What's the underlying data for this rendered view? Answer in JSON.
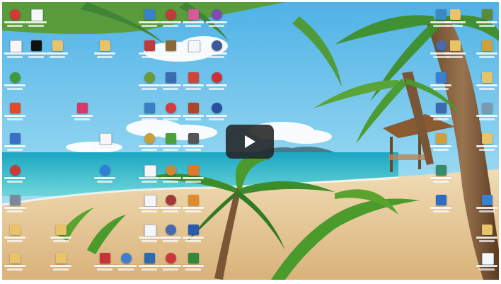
{
  "video": {
    "play_label": "Play",
    "accent": "#232323"
  },
  "desktop": {
    "colors": {
      "sky": "#7ec8ea",
      "sea": "#2fb7c9",
      "sand": "#e8cda0",
      "palm": "#3d8c2a"
    },
    "icons": [
      {
        "kind": "app",
        "color": "#d23a3a",
        "shape": "round"
      },
      {
        "kind": "doc",
        "color": "#f4f6f8",
        "shape": "doc"
      },
      {
        "kind": "doc",
        "color": "#f4f6f8",
        "shape": "doc"
      },
      {
        "kind": "app",
        "color": "#111111",
        "shape": "square"
      },
      {
        "kind": "folder",
        "color": "#e8c36a",
        "shape": "folder"
      },
      {
        "kind": "folder",
        "color": "#e8c36a",
        "shape": "folder"
      },
      {
        "kind": "app",
        "color": "#3f9a3a",
        "shape": "round"
      },
      {
        "kind": "app",
        "color": "#e04b2c",
        "shape": "square"
      },
      {
        "kind": "app",
        "color": "#d63a6a",
        "shape": "square"
      },
      {
        "kind": "app",
        "color": "#3a6fc4",
        "shape": "square"
      },
      {
        "kind": "mail",
        "color": "#f4f6f8",
        "shape": "doc"
      },
      {
        "kind": "app",
        "color": "#c83a3a",
        "shape": "round"
      },
      {
        "kind": "app",
        "color": "#2f7ed8",
        "shape": "round"
      },
      {
        "kind": "app",
        "color": "#7a8a9a",
        "shape": "square"
      },
      {
        "kind": "folder",
        "color": "#e8c36a",
        "shape": "folder"
      },
      {
        "kind": "folder",
        "color": "#e8c36a",
        "shape": "folder"
      },
      {
        "kind": "folder",
        "color": "#e8c36a",
        "shape": "folder"
      },
      {
        "kind": "folder",
        "color": "#e8c36a",
        "shape": "folder"
      },
      {
        "kind": "folder",
        "color": "#e8c36a",
        "shape": "folder"
      },
      {
        "kind": "folder",
        "color": "#e8c36a",
        "shape": "folder"
      },
      {
        "kind": "app",
        "color": "#3a7fd0",
        "shape": "square"
      },
      {
        "kind": "app",
        "color": "#c23a3a",
        "shape": "round"
      },
      {
        "kind": "app",
        "color": "#d55a9a",
        "shape": "square"
      },
      {
        "kind": "app",
        "color": "#7a4fb0",
        "shape": "round"
      },
      {
        "kind": "app",
        "color": "#c03a3a",
        "shape": "square"
      },
      {
        "kind": "app",
        "color": "#8a6a3a",
        "shape": "square"
      },
      {
        "kind": "doc",
        "color": "#f4f6f8",
        "shape": "doc"
      },
      {
        "kind": "app",
        "color": "#3a5a9a",
        "shape": "round"
      },
      {
        "kind": "app",
        "color": "#6a9a3a",
        "shape": "round"
      },
      {
        "kind": "app",
        "color": "#3a6ab0",
        "shape": "square"
      },
      {
        "kind": "app",
        "color": "#d0453a",
        "shape": "square"
      },
      {
        "kind": "app",
        "color": "#c8333a",
        "shape": "round"
      },
      {
        "kind": "app",
        "color": "#3a7fc4",
        "shape": "square"
      },
      {
        "kind": "app",
        "color": "#d63a3a",
        "shape": "round"
      },
      {
        "kind": "app",
        "color": "#b0442a",
        "shape": "square"
      },
      {
        "kind": "app",
        "color": "#2a4fa0",
        "shape": "round"
      },
      {
        "kind": "app",
        "color": "#c8a03a",
        "shape": "round"
      },
      {
        "kind": "app",
        "color": "#4aa03a",
        "shape": "square"
      },
      {
        "kind": "app",
        "color": "#555555",
        "shape": "square"
      },
      {
        "kind": "doc",
        "color": "#f4f6f8",
        "shape": "doc"
      },
      {
        "kind": "app",
        "color": "#c88a3a",
        "shape": "round"
      },
      {
        "kind": "app",
        "color": "#e07a2a",
        "shape": "square"
      },
      {
        "kind": "doc",
        "color": "#f4f6f8",
        "shape": "doc"
      },
      {
        "kind": "app",
        "color": "#a03a3a",
        "shape": "round"
      },
      {
        "kind": "app",
        "color": "#e08a2a",
        "shape": "square"
      },
      {
        "kind": "doc",
        "color": "#f4f6f8",
        "shape": "doc"
      },
      {
        "kind": "app",
        "color": "#4a6ab0",
        "shape": "round"
      },
      {
        "kind": "app",
        "color": "#2a5ab0",
        "shape": "square"
      },
      {
        "kind": "app",
        "color": "#c8333a",
        "shape": "square"
      },
      {
        "kind": "app",
        "color": "#3a7fd0",
        "shape": "round"
      },
      {
        "kind": "app",
        "color": "#2a6ab0",
        "shape": "square"
      },
      {
        "kind": "app",
        "color": "#c83a3a",
        "shape": "round"
      },
      {
        "kind": "app",
        "color": "#2f8a3a",
        "shape": "square"
      },
      {
        "kind": "app",
        "color": "#3a8ac4",
        "shape": "square"
      },
      {
        "kind": "app",
        "color": "#4a6ab0",
        "shape": "round"
      },
      {
        "kind": "app",
        "color": "#3a7fd0",
        "shape": "square"
      },
      {
        "kind": "app",
        "color": "#3a6ab0",
        "shape": "square"
      },
      {
        "kind": "app",
        "color": "#d0a03a",
        "shape": "folder"
      },
      {
        "kind": "app",
        "color": "#3a8a6a",
        "shape": "square"
      },
      {
        "kind": "app",
        "color": "#2f6ac4",
        "shape": "square"
      },
      {
        "kind": "app",
        "color": "#5a8a3a",
        "shape": "square"
      },
      {
        "kind": "app",
        "color": "#d0a03a",
        "shape": "folder"
      },
      {
        "kind": "app",
        "color": "#e8c36a",
        "shape": "folder"
      },
      {
        "kind": "app",
        "color": "#7a9ab0",
        "shape": "square"
      },
      {
        "kind": "app",
        "color": "#e8c36a",
        "shape": "folder"
      },
      {
        "kind": "app",
        "color": "#3a7fd0",
        "shape": "square"
      },
      {
        "kind": "app",
        "color": "#e8c36a",
        "shape": "folder"
      },
      {
        "kind": "doc",
        "color": "#f4f6f8",
        "shape": "doc"
      }
    ]
  }
}
